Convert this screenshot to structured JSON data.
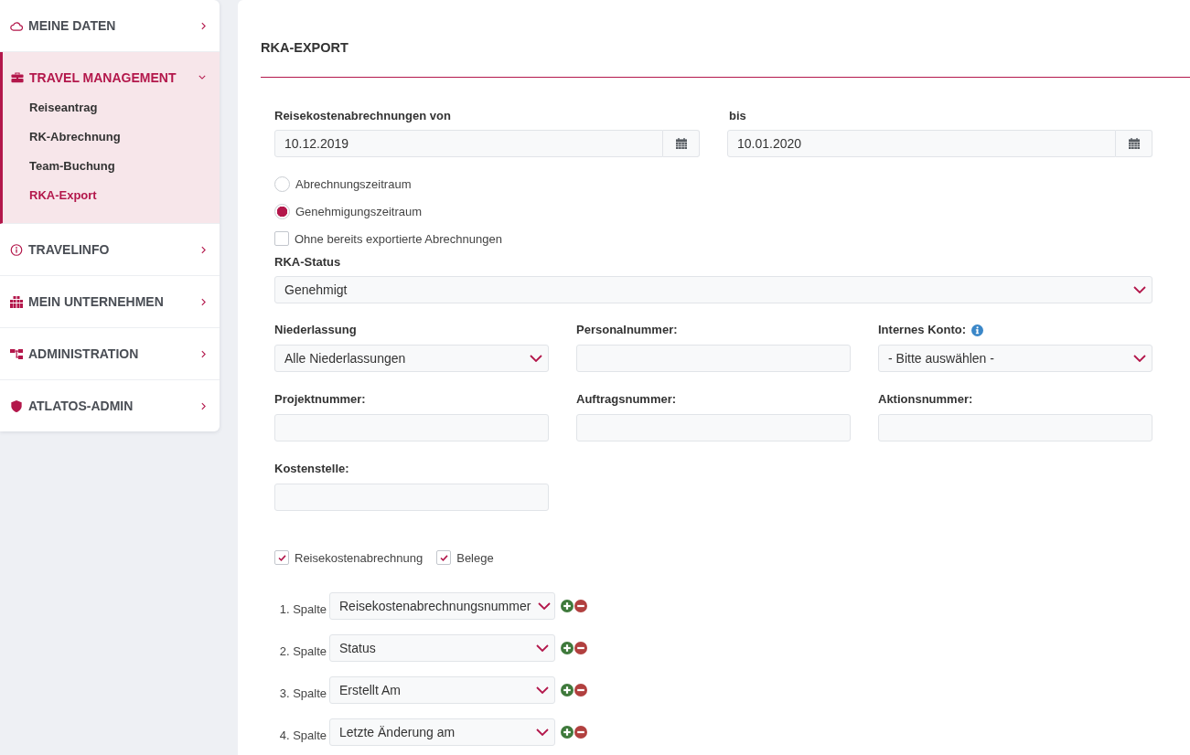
{
  "sidebar": {
    "items": [
      {
        "label": "MEINE DATEN",
        "expanded": false
      },
      {
        "label": "TRAVEL MANAGEMENT",
        "expanded": true,
        "children": [
          {
            "label": "Reiseantrag",
            "selected": false
          },
          {
            "label": "RK-Abrechnung",
            "selected": false
          },
          {
            "label": "Team-Buchung",
            "selected": false
          },
          {
            "label": "RKA-Export",
            "selected": true
          }
        ]
      },
      {
        "label": "TRAVELINFO",
        "expanded": false
      },
      {
        "label": "MEIN UNTERNEHMEN",
        "expanded": false
      },
      {
        "label": "ADMINISTRATION",
        "expanded": false
      },
      {
        "label": "ATLATOS-ADMIN",
        "expanded": false
      }
    ]
  },
  "page": {
    "title": "RKA-EXPORT"
  },
  "date_range": [
    {
      "label": "Reisekostenabrechnungen von",
      "value": "10.12.2019"
    },
    {
      "label": "bis",
      "value": "10.01.2020"
    }
  ],
  "period_options": [
    {
      "label": "Abrechnungszeitraum",
      "selected": false
    },
    {
      "label": "Genehmigungszeitraum",
      "selected": true
    }
  ],
  "exclude_exported": {
    "label": "Ohne bereits exportierte Abrechnungen",
    "checked": false
  },
  "rka_status": {
    "label": "RKA-Status",
    "value": "Genehmigt"
  },
  "filters": [
    {
      "label": "Niederlassung",
      "kind": "select",
      "value": "Alle Niederlassungen",
      "info": false
    },
    {
      "label": "Personalnummer:",
      "kind": "text",
      "info": false
    },
    {
      "label": "Internes Konto:",
      "kind": "select",
      "value": "- Bitte auswählen -",
      "info": true
    },
    {
      "label": "Projektnummer:",
      "kind": "text",
      "info": false
    },
    {
      "label": "Auftragsnummer:",
      "kind": "text",
      "info": false
    },
    {
      "label": "Aktionsnummer:",
      "kind": "text",
      "info": false
    },
    {
      "label": "Kostenstelle:",
      "kind": "text",
      "info": false
    }
  ],
  "export_contents": [
    {
      "label": "Reisekostenabrechnung",
      "checked": true
    },
    {
      "label": "Belege",
      "checked": true
    }
  ],
  "columns": [
    {
      "label": "1. Spalte",
      "value": "Reisekostenabrechnungsnummer"
    },
    {
      "label": "2. Spalte",
      "value": "Status"
    },
    {
      "label": "3. Spalte",
      "value": "Erstellt Am"
    },
    {
      "label": "4. Spalte",
      "value": "Letzte Änderung am"
    }
  ]
}
